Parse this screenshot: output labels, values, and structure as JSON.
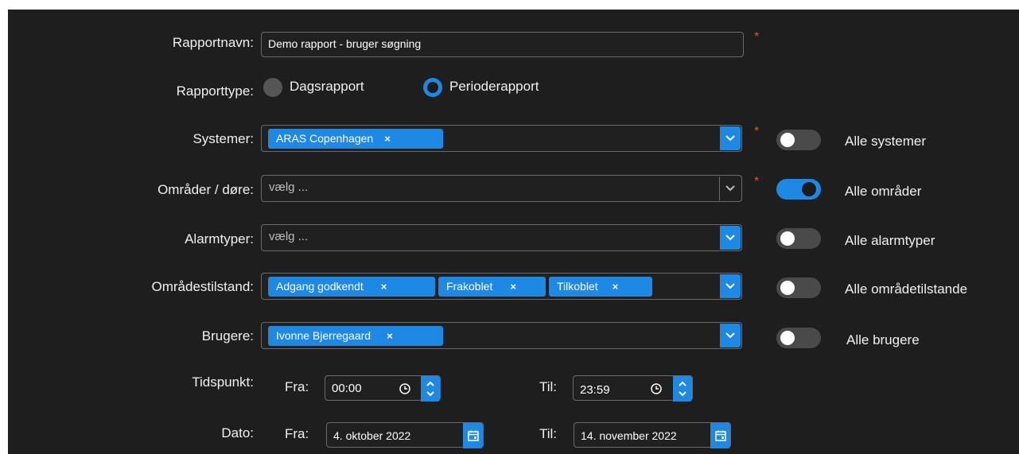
{
  "form": {
    "report_name": {
      "label": "Rapportnavn:",
      "value": "Demo rapport - bruger søgning",
      "required": "*"
    },
    "report_type": {
      "label": "Rapporttype:",
      "options": [
        {
          "label": "Dagsrapport",
          "selected": false
        },
        {
          "label": "Perioderapport",
          "selected": true
        }
      ]
    },
    "systems": {
      "label": "Systemer:",
      "chips": [
        "ARAS Copenhagen"
      ],
      "required": "*",
      "toggle_label": "Alle systemer",
      "toggle_on": false
    },
    "areas": {
      "label": "Områder / døre:",
      "placeholder": "vælg ...",
      "required": "*",
      "toggle_label": "Alle områder",
      "toggle_on": true
    },
    "alarm_types": {
      "label": "Alarmtyper:",
      "placeholder": "vælg ...",
      "toggle_label": "Alle alarmtyper",
      "toggle_on": false
    },
    "area_state": {
      "label": "Områdestilstand:",
      "chips": [
        "Adgang godkendt",
        "Frakoblet",
        "Tilkoblet"
      ],
      "toggle_label": "Alle områdetilstande",
      "toggle_on": false
    },
    "users": {
      "label": "Brugere:",
      "chips": [
        "Ivonne Bjerregaard"
      ],
      "toggle_label": "Alle brugere",
      "toggle_on": false
    },
    "time": {
      "label": "Tidspunkt:",
      "from_label": "Fra:",
      "from_value": "00:00",
      "to_label": "Til:",
      "to_value": "23:59"
    },
    "date": {
      "label": "Dato:",
      "from_label": "Fra:",
      "from_value": "4. oktober 2022",
      "to_label": "Til:",
      "to_value": "14. november 2022"
    }
  },
  "chip_remove_glyph": "×",
  "colors": {
    "accent": "#1e88e5",
    "background": "#1e1e1e",
    "required": "#e0532b",
    "toggle_off": "#4a4a4a"
  }
}
